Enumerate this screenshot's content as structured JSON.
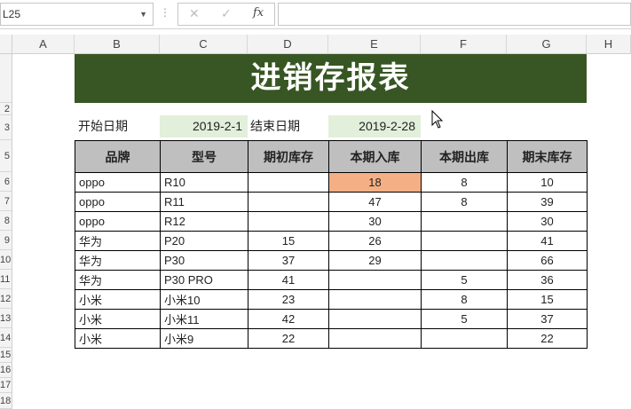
{
  "formula_bar": {
    "name_box": "L25",
    "cancel_icon": "✕",
    "enter_icon": "✓",
    "fx_label": "fx",
    "formula": ""
  },
  "columns": [
    "A",
    "B",
    "C",
    "D",
    "E",
    "F",
    "G",
    "H"
  ],
  "row_numbers": [
    "2",
    "3",
    "5",
    "6",
    "7",
    "8",
    "9",
    "10",
    "11",
    "12",
    "13",
    "14",
    "15",
    "16",
    "17",
    "18"
  ],
  "banner_title": "进销存报表",
  "date_range": {
    "start_label": "开始日期",
    "start_value": "2019-2-1",
    "end_label": "结束日期",
    "end_value": "2019-2-28"
  },
  "table": {
    "headers": [
      "品牌",
      "型号",
      "期初库存",
      "本期入库",
      "本期出库",
      "期末库存"
    ],
    "rows": [
      [
        "oppo",
        "R10",
        "",
        "18",
        "8",
        "10"
      ],
      [
        "oppo",
        "R11",
        "",
        "47",
        "8",
        "39"
      ],
      [
        "oppo",
        "R12",
        "",
        "30",
        "",
        "30"
      ],
      [
        "华为",
        "P20",
        "15",
        "26",
        "",
        "41"
      ],
      [
        "华为",
        "P30",
        "37",
        "29",
        "",
        "66"
      ],
      [
        "华为",
        "P30 PRO",
        "41",
        "",
        "5",
        "36"
      ],
      [
        "小米",
        "小米10",
        "23",
        "",
        "8",
        "15"
      ],
      [
        "小米",
        "小米11",
        "42",
        "",
        "5",
        "37"
      ],
      [
        "小米",
        "小米9",
        "22",
        "",
        "",
        "22"
      ]
    ],
    "highlight_color": "#f4b084"
  },
  "colors": {
    "banner_bg": "#375623",
    "date_cell_bg": "#e2efda",
    "header_bg": "#bfbfbf"
  }
}
